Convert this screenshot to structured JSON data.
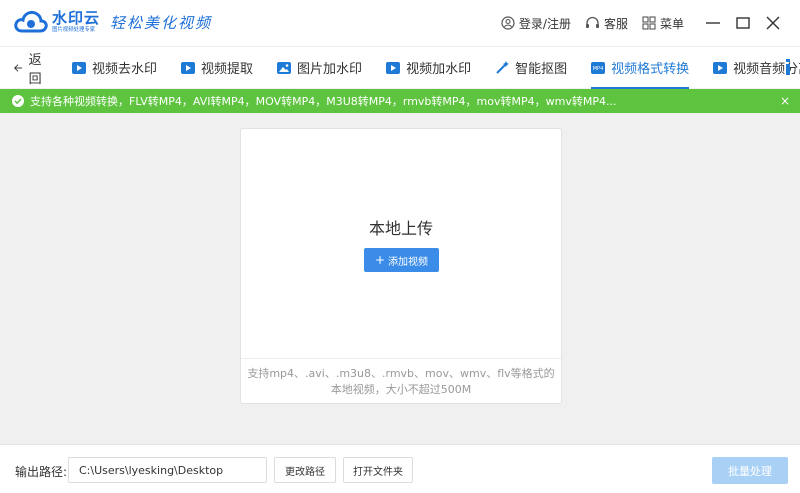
{
  "titlebar": {
    "logo_name": "水印云",
    "logo_sub": "图片视频处理专家",
    "slogan": "轻松美化视频",
    "login": "登录/注册",
    "service": "客服",
    "menu": "菜单"
  },
  "nav": {
    "back": "返回",
    "items": [
      {
        "label": "视频去水印"
      },
      {
        "label": "视频提取"
      },
      {
        "label": "图片加水印"
      },
      {
        "label": "视频加水印"
      },
      {
        "label": "智能抠图"
      },
      {
        "label": "视频格式转换",
        "active": true
      },
      {
        "label": "视频音频分离"
      }
    ]
  },
  "notice": {
    "text": "支持各种视频转换，FLV转MP4，AVI转MP4，MOV转MP4，M3U8转MP4，rmvb转MP4，mov转MP4，wmv转MP4...",
    "close": "×"
  },
  "upload": {
    "title": "本地上传",
    "add_button": "添加视频",
    "hint_line1": "支持mp4、.avi、.m3u8、.rmvb、mov、wmv、flv等格式的",
    "hint_line2": "本地视频，大小不超过500M"
  },
  "bottom": {
    "output_label": "输出路径:",
    "output_path": "C:\\Users\\lyesking\\Desktop",
    "change_path": "更改路径",
    "open_folder": "打开文件夹",
    "batch": "批量处理"
  },
  "colors": {
    "accent": "#1f7ad6",
    "notice_green": "#5ec43f",
    "primary_button": "#3b8ce8",
    "disabled_button": "#a9d0f5"
  }
}
